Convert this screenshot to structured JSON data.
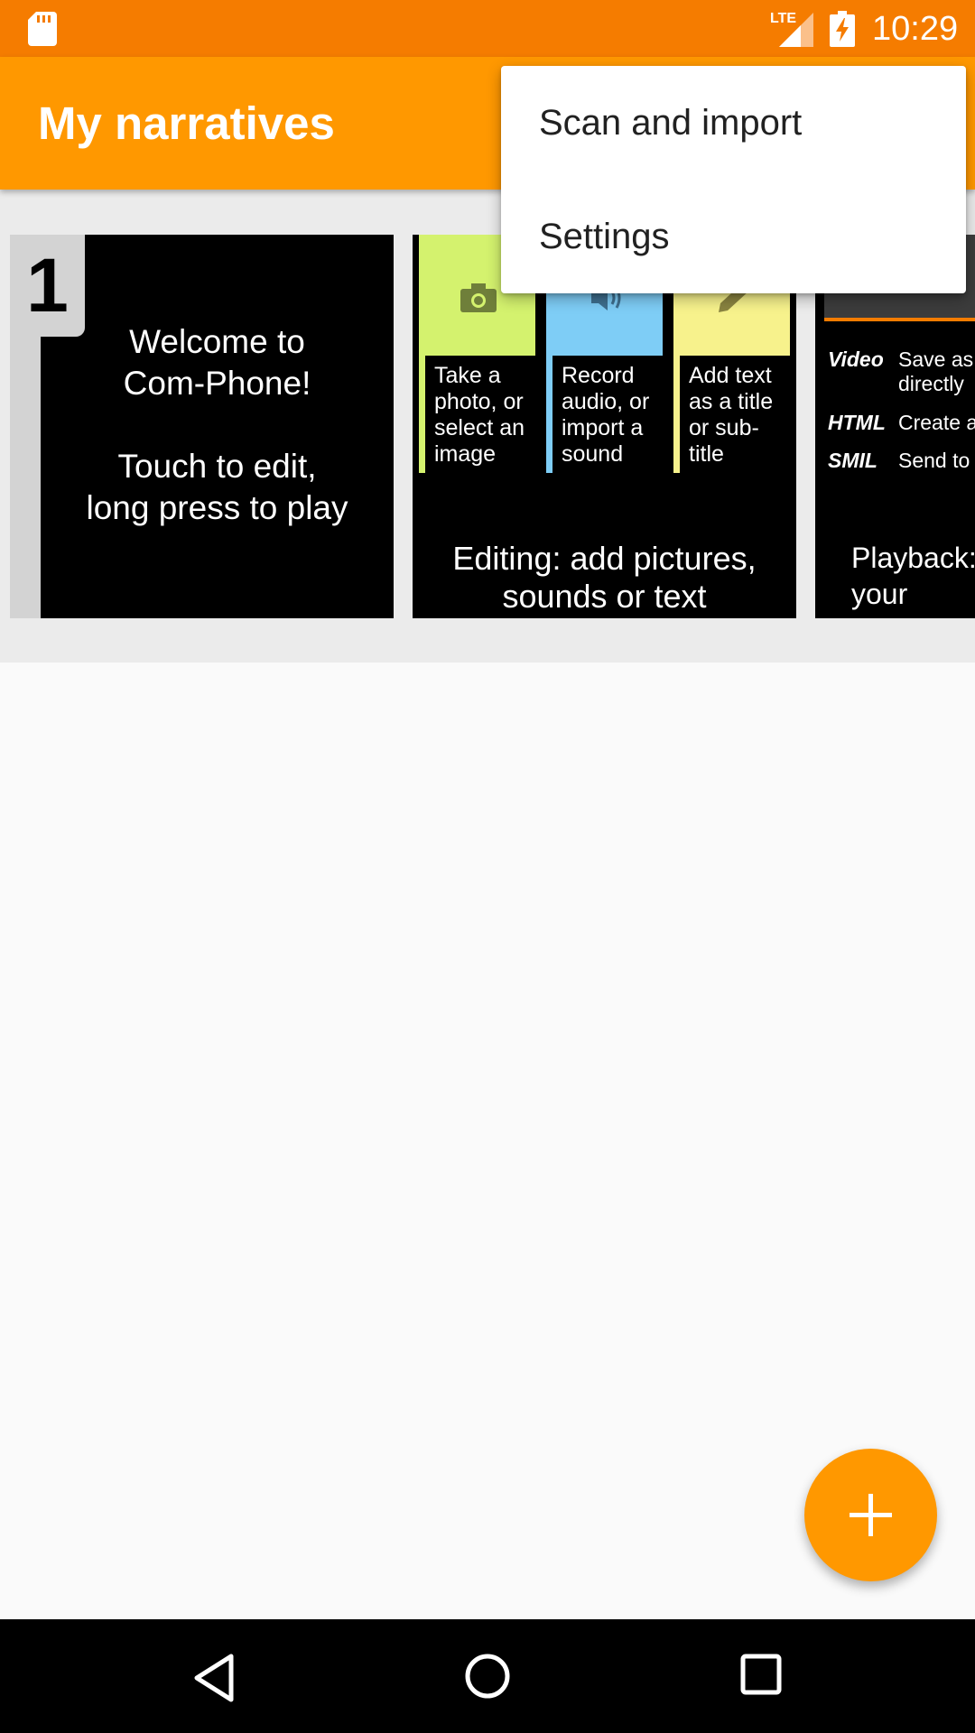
{
  "status_bar": {
    "time": "10:29",
    "network": "LTE",
    "icons": [
      "sd-card-icon",
      "lte-signal-icon",
      "battery-charging-icon"
    ]
  },
  "app_bar": {
    "title": "My narratives"
  },
  "overflow_menu": {
    "items": [
      {
        "label": "Scan and import"
      },
      {
        "label": "Settings"
      }
    ]
  },
  "narrative": {
    "number": "1",
    "frames": [
      {
        "lines": [
          "Welcome to",
          "Com-Phone!",
          "Touch to edit,",
          "long press to play"
        ]
      },
      {
        "panels": [
          {
            "icon": "camera-icon",
            "text": "Take a\nphoto, or\nselect an\nimage"
          },
          {
            "icon": "speaker-icon",
            "text": "Record\naudio, or\nimport a\nsound"
          },
          {
            "icon": "pencil-icon",
            "text": "Add text\nas a title\nor sub-\ntitle"
          }
        ],
        "caption": "Editing: add pictures,\nsounds or text"
      },
      {
        "rows": [
          {
            "key": "Video",
            "value": "Save as\ndirectly"
          },
          {
            "key": "HTML",
            "value": "Create a"
          },
          {
            "key": "SMIL",
            "value": "Send to"
          }
        ],
        "caption": "Playback:\nyour"
      }
    ]
  },
  "fab": {
    "icon": "plus-icon"
  },
  "navigation": {
    "icons": [
      "back-icon",
      "home-icon",
      "recents-icon"
    ]
  },
  "colors": {
    "status_bar": "#f57c00",
    "app_bar": "#ff9800",
    "accent": "#ff9800",
    "panel_green": "#d4f26e",
    "panel_blue": "#7ecdf6",
    "panel_yellow": "#f7f28c"
  }
}
